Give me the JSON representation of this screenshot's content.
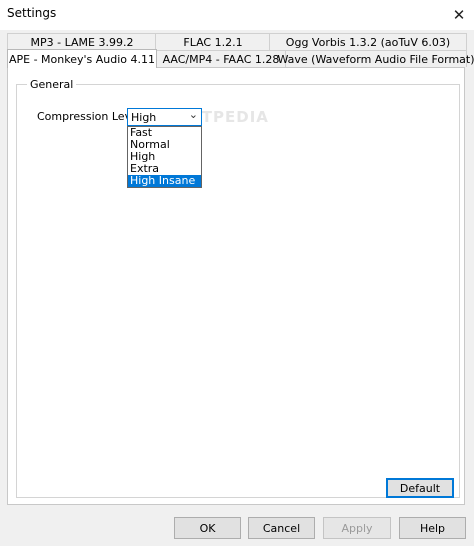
{
  "window": {
    "title": "Settings",
    "close_glyph": "✕"
  },
  "tabs_back": [
    "MP3 - LAME 3.99.2",
    "FLAC 1.2.1",
    "Ogg Vorbis 1.3.2 (aoTuV 6.03)"
  ],
  "tabs_front": [
    "APE - Monkey's Audio 4.11",
    "AAC/MP4 - FAAC 1.28",
    "Wave (Waveform Audio File Format)"
  ],
  "group": {
    "title": "General"
  },
  "compression": {
    "label": "Compression Level:",
    "selected": "High",
    "options": [
      "Fast",
      "Normal",
      "High",
      "Extra",
      "High Insane"
    ],
    "highlighted": "High Insane"
  },
  "watermark": "SOFTPEDIA",
  "buttons": {
    "default": "Default",
    "ok": "OK",
    "cancel": "Cancel",
    "apply": "Apply",
    "help": "Help"
  }
}
